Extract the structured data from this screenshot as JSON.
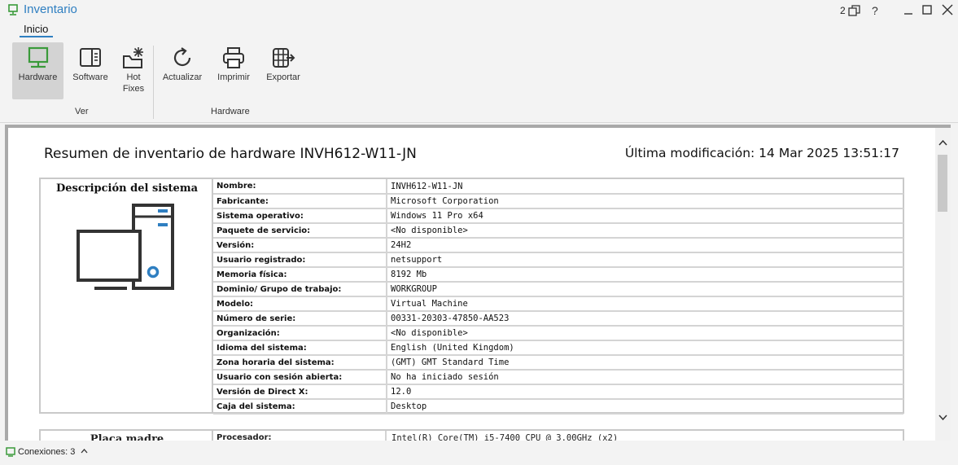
{
  "window": {
    "title": "Inventario",
    "connections_count": "2",
    "help": "?"
  },
  "ribbon": {
    "tab": "Inicio",
    "groups": [
      {
        "label": "Ver"
      },
      {
        "label": "Hardware"
      }
    ],
    "buttons": {
      "hardware": "Hardware",
      "software": "Software",
      "hotfixes_line1": "Hot",
      "hotfixes_line2": "Fixes",
      "refresh": "Actualizar",
      "print": "Imprimir",
      "export": "Exportar"
    }
  },
  "report": {
    "title": "Resumen de inventario de hardware INVH612-W11-JN",
    "modified": "Última modificación: 14 Mar 2025 13:51:17",
    "section": "Descripción del sistema",
    "rows": [
      {
        "key": "Nombre:",
        "value": "INVH612-W11-JN"
      },
      {
        "key": "Fabricante:",
        "value": "Microsoft Corporation"
      },
      {
        "key": "Sistema operativo:",
        "value": "Windows 11 Pro x64"
      },
      {
        "key": "Paquete de servicio:",
        "value": "<No disponible>"
      },
      {
        "key": "Versión:",
        "value": "24H2"
      },
      {
        "key": "Usuario registrado:",
        "value": "netsupport"
      },
      {
        "key": "Memoria física:",
        "value": "8192 Mb"
      },
      {
        "key": "Dominio/ Grupo de trabajo:",
        "value": "WORKGROUP"
      },
      {
        "key": "Modelo:",
        "value": "Virtual Machine"
      },
      {
        "key": "Número de serie:",
        "value": "00331-20303-47850-AA523"
      },
      {
        "key": "Organización:",
        "value": "<No disponible>"
      },
      {
        "key": "Idioma del sistema:",
        "value": "English (United Kingdom)"
      },
      {
        "key": "Zona horaria del sistema:",
        "value": "(GMT) GMT Standard Time"
      },
      {
        "key": "Usuario con sesión abierta:",
        "value": "No ha iniciado sesión"
      },
      {
        "key": "Versión de Direct X:",
        "value": "12.0"
      },
      {
        "key": "Caja del sistema:",
        "value": "Desktop"
      }
    ],
    "next_section": "Placa madre",
    "next_key": "Procesador:",
    "next_value": "Intel(R) Core(TM) i5-7400 CPU @ 3.00GHz (x2)"
  },
  "statusbar": {
    "text": "Conexiones: 3"
  },
  "colors": {
    "accent": "#2f7fc1",
    "green": "#3a9a3a"
  }
}
